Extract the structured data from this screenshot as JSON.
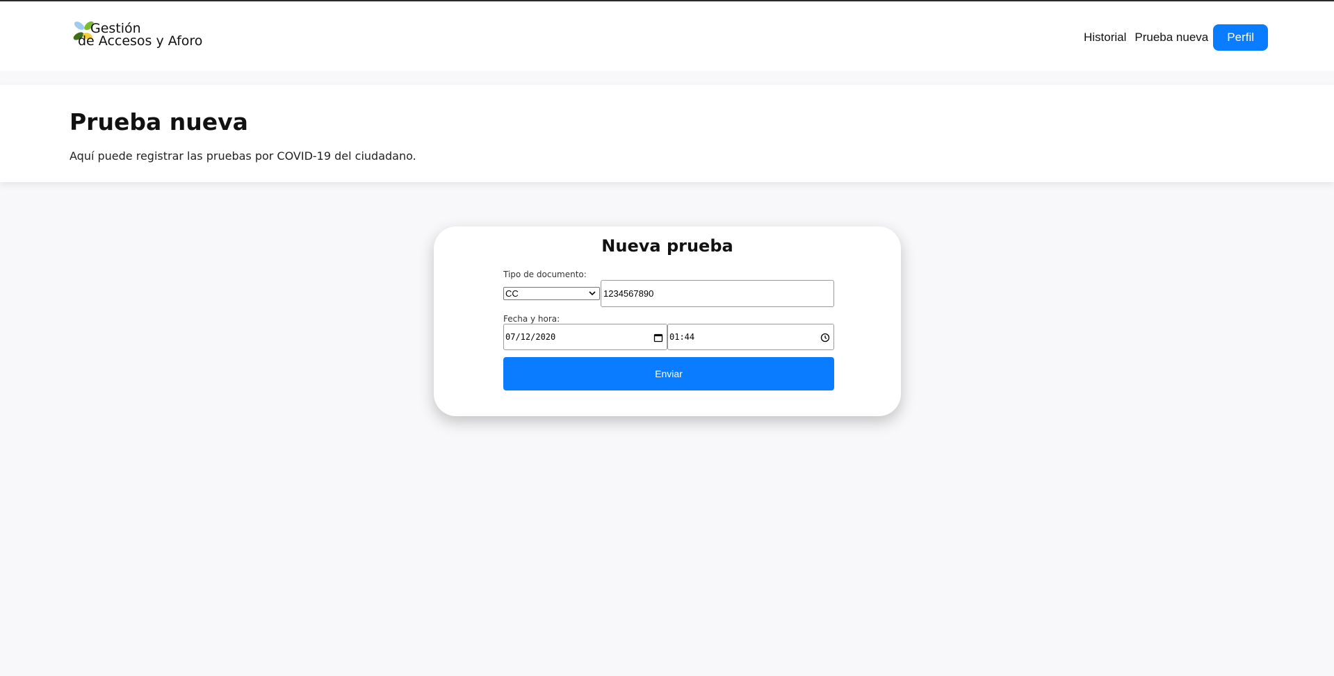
{
  "navbar": {
    "brand_line1": "Gestión",
    "brand_line2": "de Accesos y Aforo",
    "links": [
      {
        "label": "Historial"
      },
      {
        "label": "Prueba nueva"
      }
    ],
    "profile_button": "Perfil",
    "accent_color": "#0a7cff"
  },
  "header": {
    "title": "Prueba nueva",
    "subtitle": "Aquí puede registrar las pruebas por COVID-19 del ciudadano."
  },
  "form": {
    "title": "Nueva prueba",
    "doc_type_label": "Tipo de documento:",
    "doc_type_selected": "CC",
    "doc_number_value": "1234567890",
    "datetime_label": "Fecha y hora:",
    "date_value": "07/12/2020",
    "time_value": "01:44",
    "submit_label": "Enviar"
  },
  "icons": {
    "logo": "leaves-logo-icon",
    "select": "chevron-down-icon",
    "date": "calendar-icon",
    "time": "clock-icon"
  }
}
